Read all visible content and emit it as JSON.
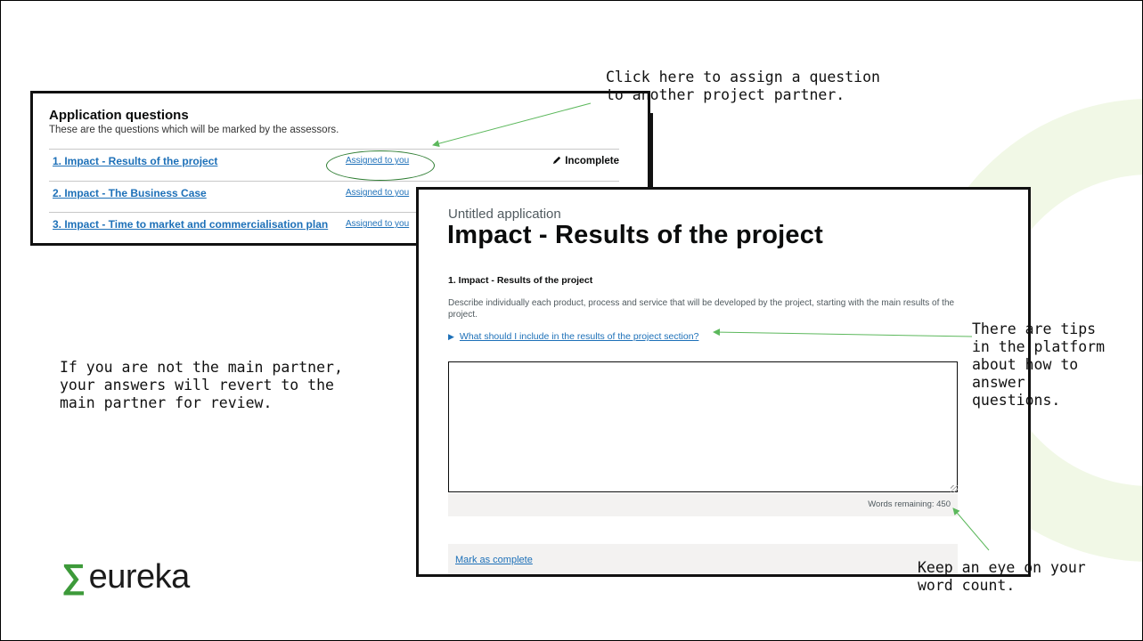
{
  "callouts": {
    "assign": "Click here to assign a question\nto another project partner.",
    "not_main_partner": "If you are not the main partner,\nyour answers will revert to the\nmain partner for review.",
    "tips": "There are tips\nin the platform\nabout how to\nanswer\nquestions.",
    "word_count": "Keep an eye on your\nword count."
  },
  "questions_panel": {
    "title": "Application questions",
    "subtitle": "These are the questions which will be marked by the assessors.",
    "rows": [
      {
        "question": "1. Impact - Results of the project",
        "assignment": "Assigned to you",
        "status": "Incomplete"
      },
      {
        "question": "2. Impact - The Business Case",
        "assignment": "Assigned to you",
        "status": ""
      },
      {
        "question": "3. Impact - Time to market and commercialisation plan",
        "assignment": "Assigned to you",
        "status": ""
      }
    ]
  },
  "question_page": {
    "caption": "Untitled application",
    "heading": "Impact - Results of the project",
    "question_label": "1. Impact - Results of the project",
    "hint": "Describe individually each product, process and service that will be developed by the project, starting with the main results of the project.",
    "details_link": "What should I include in the results of the project section?",
    "answer_value": "",
    "words_remaining": "Words remaining: 450",
    "mark_complete": "Mark as complete"
  },
  "logo": {
    "symbol": "∑",
    "text": "eureka"
  },
  "colors": {
    "link": "#1d70b8",
    "arrow": "#5cb85c",
    "logo_green": "#3d9a3a",
    "deco": "#f1f8e6"
  },
  "icons": {
    "status": "pencil-icon",
    "details": "triangle-right-icon"
  }
}
